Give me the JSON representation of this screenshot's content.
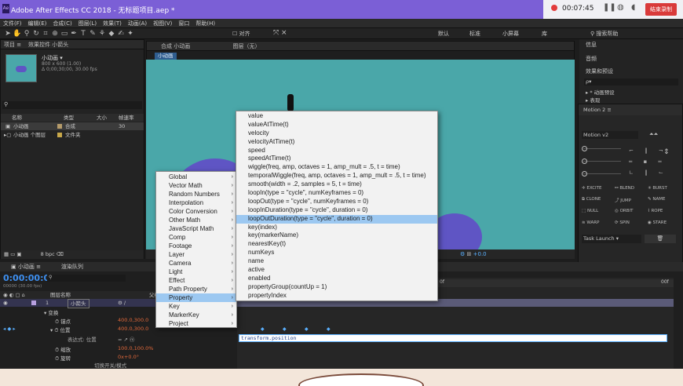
{
  "window": {
    "title": "Adobe After Effects CC 2018 - 无标题项目.aep *"
  },
  "recorder": {
    "time": "00:07:45",
    "stop_label": "结束录制"
  },
  "menubar": [
    "文件(F)",
    "编辑(E)",
    "合成(C)",
    "图层(L)",
    "效果(T)",
    "动画(A)",
    "视图(V)",
    "窗口",
    "帮助(H)"
  ],
  "toolbar": {
    "workspaces": [
      "默认",
      "标准",
      "小屏幕",
      "库"
    ],
    "search_placeholder": "搜索帮助",
    "snap_label": "对齐"
  },
  "project": {
    "tab": "项目",
    "tab2": "效果控件 小箭头",
    "item_name": "小动画 ▾",
    "item_info1": "800 x 600 (1.00)",
    "item_info2": "Δ 0;00;30;00, 30.00 fps",
    "headers": [
      "名称",
      "类型",
      "大小",
      "帧速率"
    ],
    "rows": [
      {
        "name": "小动画",
        "type": "合成",
        "rate": "30"
      },
      {
        "name": "小动画 个图层",
        "type": "文件夹",
        "rate": ""
      }
    ],
    "bpc": "8 bpc"
  },
  "comp": {
    "tab": "合成 小动画",
    "tab2": "图层（无）",
    "crumb": "小动画",
    "footer": "+0.0"
  },
  "right": {
    "info": "信息",
    "audio": "音频",
    "effects": "效果和预设",
    "search": "ρ▾",
    "anim": "▸ * 动画预设",
    "tab": "▸ 表现"
  },
  "motion": {
    "title": "Motion 2",
    "version": "Motion v2",
    "buttons": [
      "EXCITE",
      "BLEND",
      "BURST",
      "CLONE",
      "JUMP",
      "NAME",
      "NULL",
      "ORBIT",
      "ROPE",
      "WARP",
      "SPIN",
      "STARE"
    ],
    "task": "Task Launch"
  },
  "timeline": {
    "comp_tab": "小动画",
    "render_tab": "渲染队列",
    "timecode": "0:00:00:00",
    "fps": "00000 (30.00 fps)",
    "col_name": "图层名称",
    "col_parent": "父级",
    "layer_num": "1",
    "layer_name": "小箭头",
    "transform": "变换",
    "anchor": "锚点",
    "anchor_val": "400.0,300.0",
    "position": "位置",
    "position_val": "400.0,300.0",
    "expr_label": "表达式: 位置",
    "scale": "缩放",
    "scale_val": "100.0,100.0%",
    "rotation": "旋转",
    "rotation_val": "0x+0.0°",
    "expr_text": "transform.position",
    "bottom": "切换开关/模式",
    "ruler": [
      "0f",
      "00f"
    ]
  },
  "menu_categories": [
    {
      "label": "Global",
      "sub": true
    },
    {
      "label": "Vector Math",
      "sub": true
    },
    {
      "label": "Random Numbers",
      "sub": true
    },
    {
      "label": "Interpolation",
      "sub": true
    },
    {
      "label": "Color Conversion",
      "sub": true
    },
    {
      "label": "Other Math",
      "sub": true
    },
    {
      "label": "JavaScript Math",
      "sub": true
    },
    {
      "label": "Comp",
      "sub": true
    },
    {
      "label": "Footage",
      "sub": true
    },
    {
      "label": "Layer",
      "sub": true
    },
    {
      "label": "Camera",
      "sub": true
    },
    {
      "label": "Light",
      "sub": true
    },
    {
      "label": "Effect",
      "sub": true
    },
    {
      "label": "Path Property",
      "sub": true
    },
    {
      "label": "Property",
      "sub": true,
      "selected": true
    },
    {
      "label": "Key",
      "sub": true
    },
    {
      "label": "MarkerKey",
      "sub": true
    },
    {
      "label": "Project",
      "sub": true
    }
  ],
  "menu_expressions": [
    "value",
    "valueAtTime(t)",
    "velocity",
    "velocityAtTime(t)",
    "speed",
    "speedAtTime(t)",
    "wiggle(freq, amp, octaves = 1, amp_mult = .5, t = time)",
    "temporalWiggle(freq, amp, octaves = 1, amp_mult = .5, t = time)",
    "smooth(width = .2, samples = 5, t = time)",
    "loopIn(type = \"cycle\", numKeyframes = 0)",
    "loopOut(type = \"cycle\", numKeyframes = 0)",
    "loopInDuration(type = \"cycle\", duration = 0)",
    "loopOutDuration(type = \"cycle\", duration = 0)",
    "key(index)",
    "key(markerName)",
    "nearestKey(t)",
    "numKeys",
    "name",
    "active",
    "enabled",
    "propertyGroup(countUp = 1)",
    "propertyIndex"
  ],
  "selected_expression_index": 12,
  "colors": {
    "titlebar": "#7b5fd6",
    "canvas": "#4aa7a9",
    "shape": "#5f55c4",
    "highlight": "#9cc8f1",
    "timecode": "#3d8ff0"
  }
}
